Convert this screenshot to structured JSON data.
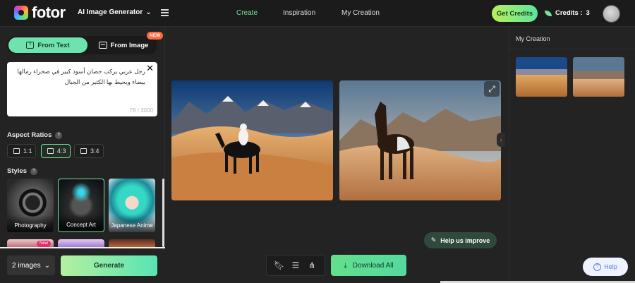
{
  "header": {
    "logo_text": "fotor",
    "tool_select": "AI Image Generator",
    "nav": [
      "Create",
      "Inspiration",
      "My Creation"
    ],
    "get_credits": "Get Credits",
    "credits_label": "Credits :",
    "credits_value": "3"
  },
  "left_panel": {
    "mode_from_text": "From Text",
    "mode_from_image": "From Image",
    "new_badge": "NEW",
    "prompt": "رجل عربي يركب حصان أسود كبير في صحراء رمالها بيضاء ويحيط بها الكثير من الجبال",
    "prompt_count": "78 / 3000",
    "aspect_title": "Aspect Ratios",
    "ratios": [
      "1:1",
      "4:3",
      "3:4"
    ],
    "selected_ratio": "4:3",
    "styles_title": "Styles",
    "styles": [
      "Photography",
      "Concept Art",
      "Japanese Anime"
    ],
    "selected_style": "Concept Art",
    "new_tag": "New",
    "image_count": "2 images",
    "generate": "Generate"
  },
  "main": {
    "help_improve": "Help us improve",
    "download_all": "Download All"
  },
  "right_panel": {
    "title": "My Creation"
  },
  "help_button": "Help",
  "colors": {
    "accent": "#6ee39b",
    "background": "#232323"
  }
}
